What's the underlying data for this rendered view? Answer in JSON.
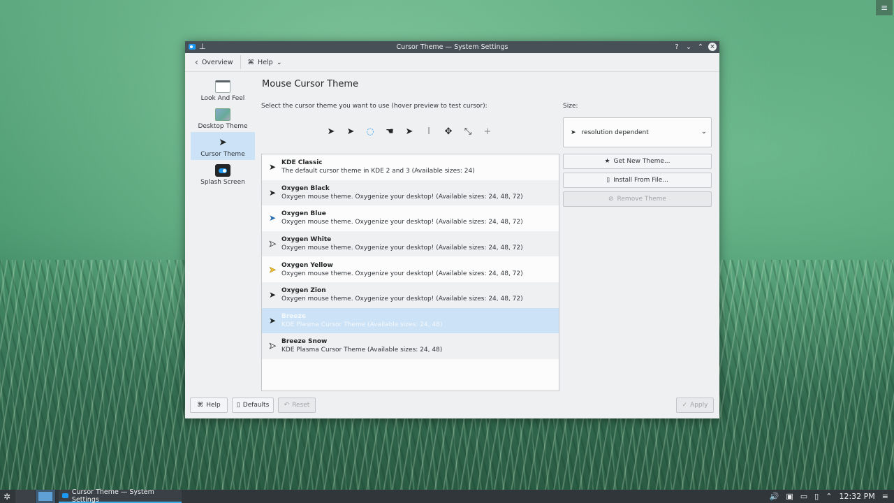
{
  "window": {
    "title": "Cursor Theme — System Settings",
    "help_glyph": "?",
    "min_glyph": "⌄",
    "max_glyph": "⌃",
    "close_glyph": "×"
  },
  "toolbar": {
    "overview_label": "Overview",
    "help_label": "Help"
  },
  "sidebar": {
    "items": [
      {
        "label": "Look And Feel",
        "icon": "look-and-feel-icon"
      },
      {
        "label": "Desktop Theme",
        "icon": "desktop-theme-icon"
      },
      {
        "label": "Cursor Theme",
        "icon": "cursor-theme-icon",
        "active": true
      },
      {
        "label": "Splash Screen",
        "icon": "splash-screen-icon"
      }
    ]
  },
  "main": {
    "title": "Mouse Cursor Theme",
    "instruction": "Select the cursor theme you want to use (hover preview to test cursor):",
    "preview_icons": [
      "arrow-cursor-icon",
      "busy-arrow-cursor-icon",
      "wait-cursor-icon",
      "hand-cursor-icon",
      "help-cursor-icon",
      "text-cursor-icon",
      "move-cursor-icon",
      "resize-diagonal-cursor-icon",
      "crosshair-cursor-icon"
    ],
    "themes": [
      {
        "name": "KDE Classic",
        "desc": "The default cursor theme in KDE 2 and 3 (Available sizes: 24)"
      },
      {
        "name": "Oxygen Black",
        "desc": "Oxygen mouse theme. Oxygenize your desktop! (Available sizes: 24, 48, 72)"
      },
      {
        "name": "Oxygen Blue",
        "desc": "Oxygen mouse theme. Oxygenize your desktop! (Available sizes: 24, 48, 72)"
      },
      {
        "name": "Oxygen White",
        "desc": "Oxygen mouse theme. Oxygenize your desktop! (Available sizes: 24, 48, 72)"
      },
      {
        "name": "Oxygen Yellow",
        "desc": "Oxygen mouse theme. Oxygenize your desktop! (Available sizes: 24, 48, 72)"
      },
      {
        "name": "Oxygen Zion",
        "desc": "Oxygen mouse theme. Oxygenize your desktop! (Available sizes: 24, 48, 72)"
      },
      {
        "name": "Breeze",
        "desc": "KDE Plasma Cursor Theme (Available sizes: 24, 48)",
        "selected": true
      },
      {
        "name": "Breeze Snow",
        "desc": "KDE Plasma Cursor Theme (Available sizes: 24, 48)"
      }
    ],
    "size_label": "Size:",
    "size_value": "resolution dependent",
    "get_new_label": "Get New Theme...",
    "install_label": "Install From File...",
    "remove_label": "Remove Theme"
  },
  "footer": {
    "help_label": "Help",
    "defaults_label": "Defaults",
    "reset_label": "Reset",
    "apply_label": "Apply"
  },
  "taskbar": {
    "task_label": "Cursor Theme — System Settings",
    "clock": "12:32 PM"
  },
  "colors": {
    "accent": "#3daee9",
    "selection": "#cce2f6",
    "titlebar": "#475057",
    "panel": "#31363b"
  }
}
